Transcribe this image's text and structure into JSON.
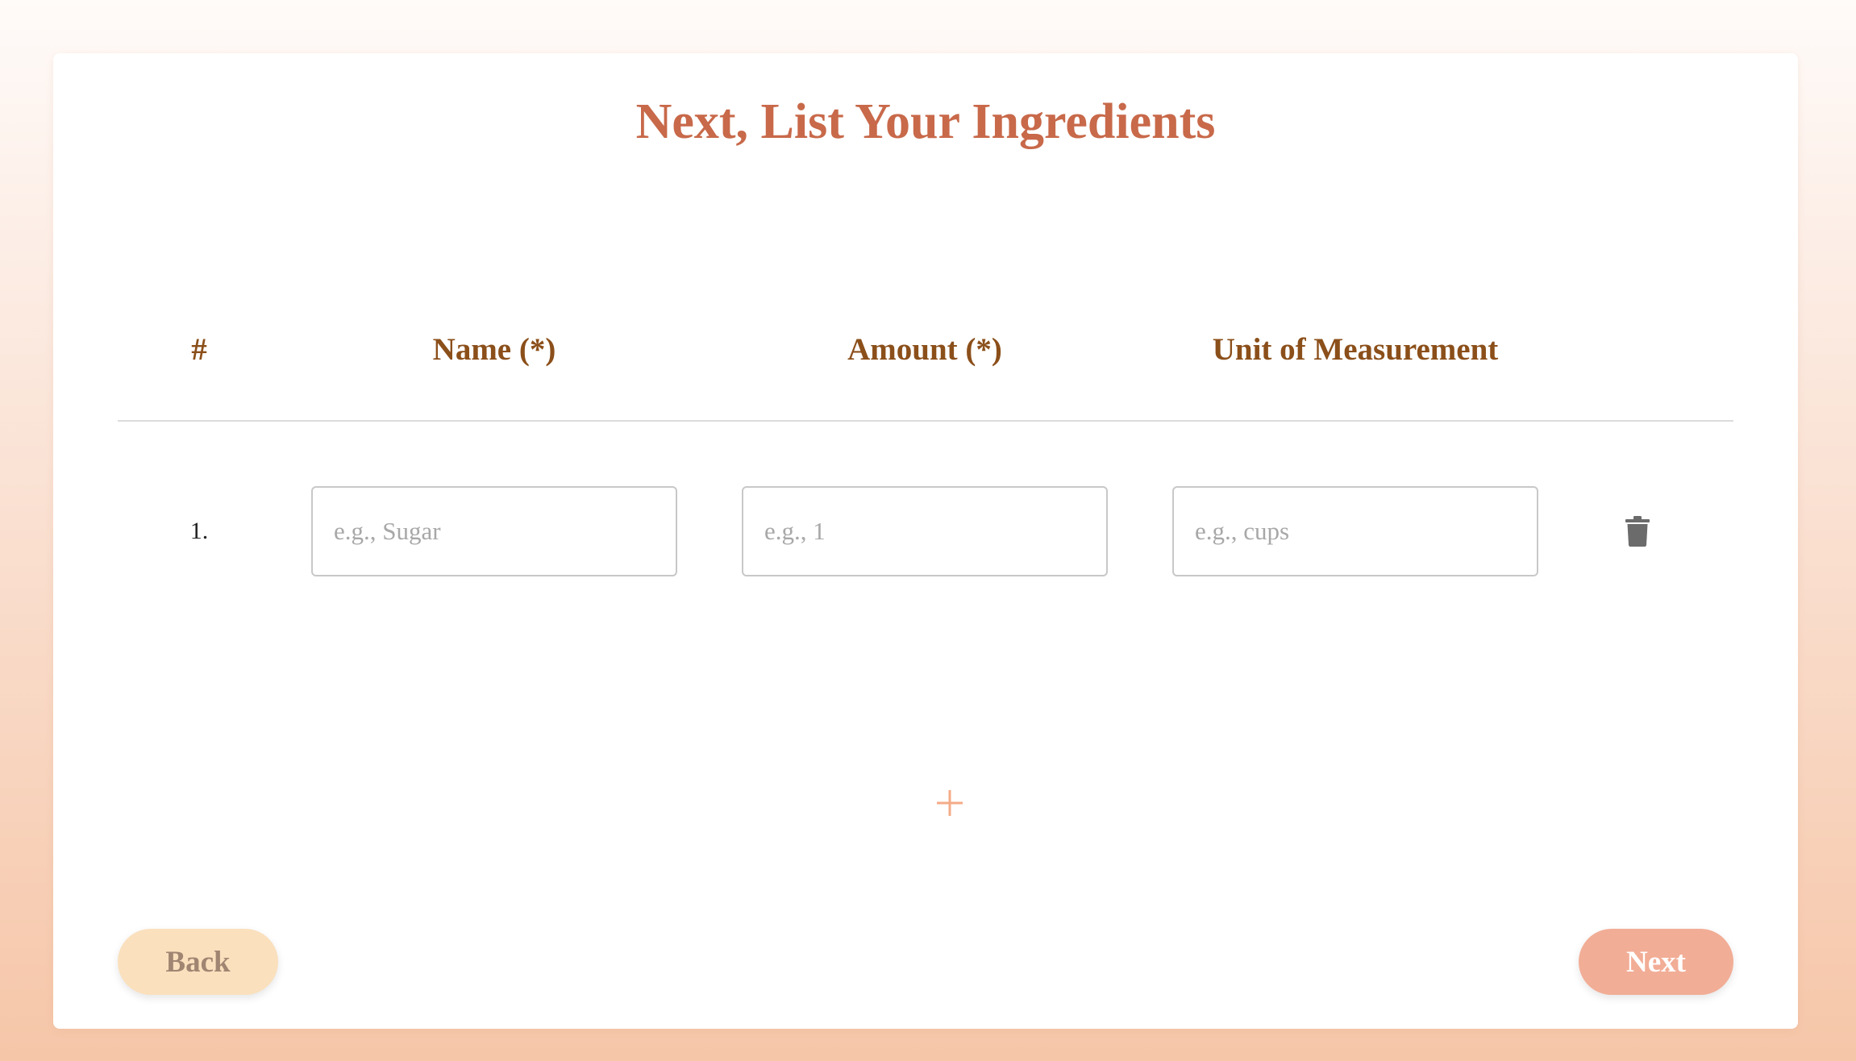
{
  "page": {
    "title": "Next, List Your Ingredients"
  },
  "table": {
    "headers": [
      "#",
      "Name (*)",
      "Amount (*)",
      "Unit of Measurement"
    ],
    "rows": [
      {
        "number": "1.",
        "name": {
          "value": "",
          "placeholder": "e.g., Sugar"
        },
        "amount": {
          "value": "",
          "placeholder": "e.g., 1"
        },
        "unit": {
          "value": "",
          "placeholder": "e.g., cups"
        },
        "delete_icon": "trash-icon"
      }
    ]
  },
  "add_row": {
    "icon": "plus-icon"
  },
  "navigation": {
    "back_label": "Back",
    "next_label": "Next"
  },
  "colors": {
    "title": "#c8694a",
    "header": "#8b4f1a",
    "accent": "#f2ad96",
    "back_button": "#fae0bd",
    "plus": "#f4ab88"
  }
}
